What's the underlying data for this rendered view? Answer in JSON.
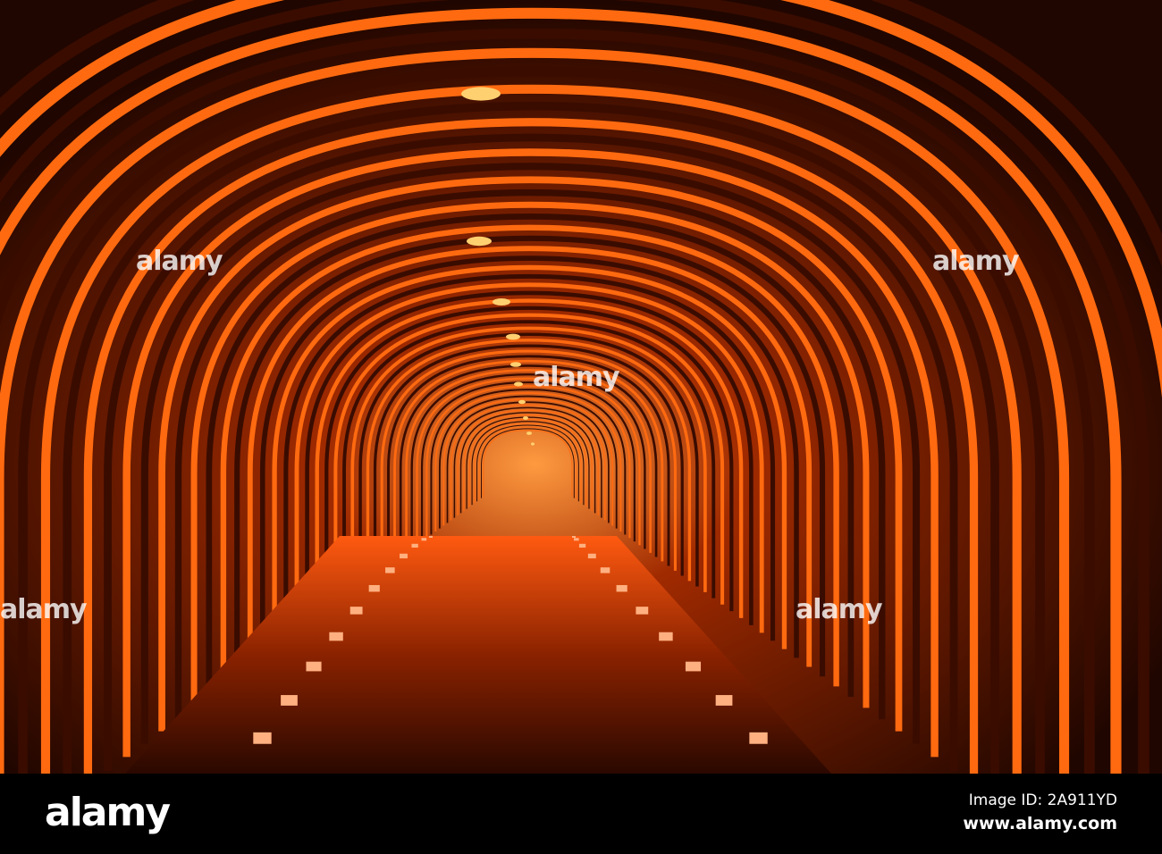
{
  "photo": {
    "subject": "illuminated orange tunnel with road",
    "colors": {
      "glow": "#ff6a10",
      "dark": "#1a0500",
      "lamp": "#ffd070"
    }
  },
  "watermark": {
    "text": "alamy"
  },
  "footer": {
    "logo": "alamy",
    "image_id": "Image ID: 2A911YD",
    "website": "www.alamy.com"
  }
}
